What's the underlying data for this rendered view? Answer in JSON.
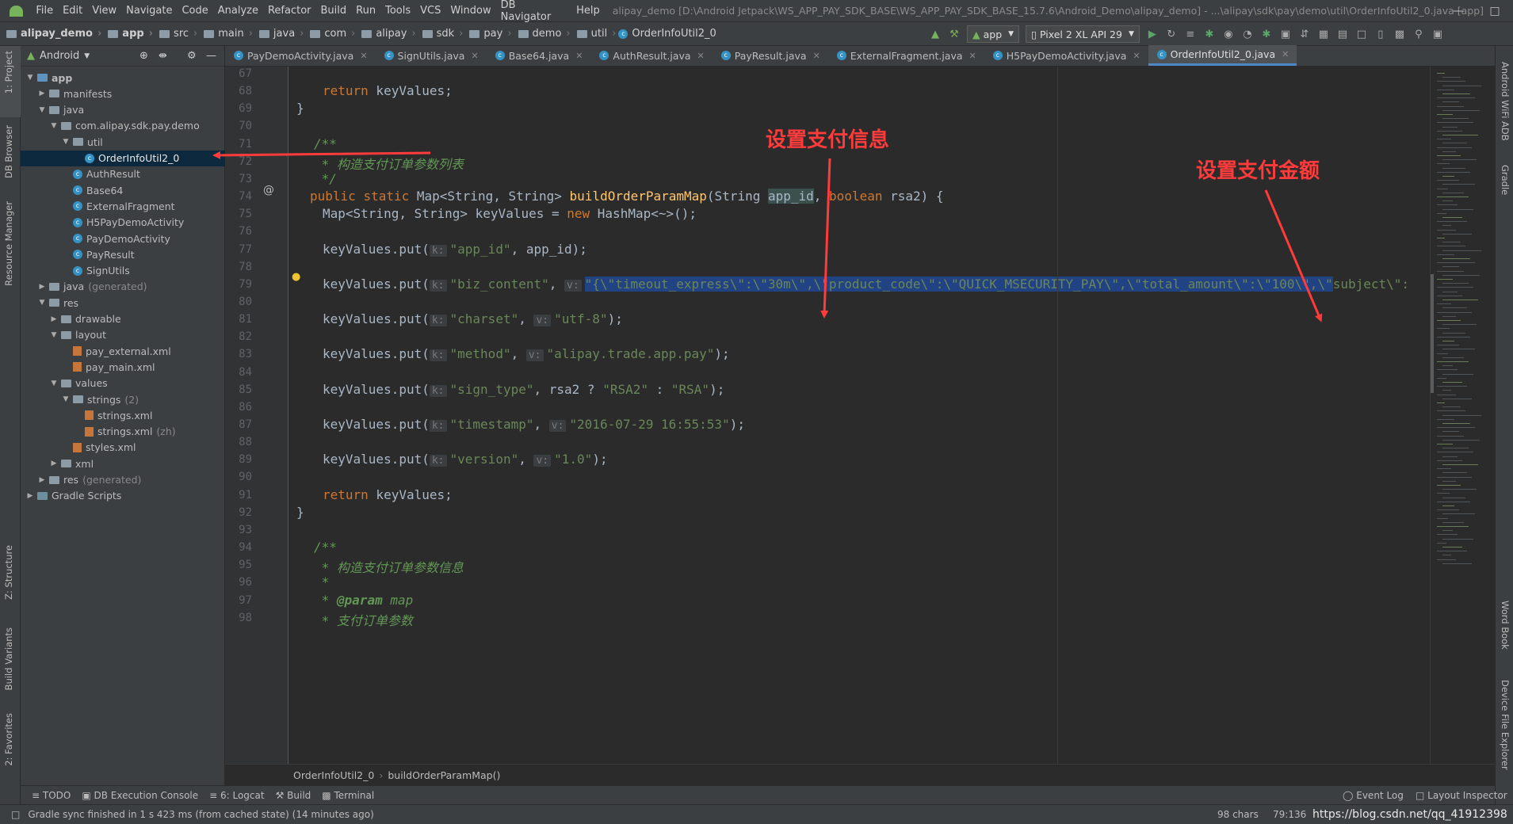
{
  "menu": {
    "items": [
      "File",
      "Edit",
      "View",
      "Navigate",
      "Code",
      "Analyze",
      "Refactor",
      "Build",
      "Run",
      "Tools",
      "VCS",
      "Window",
      "DB Navigator",
      "Help"
    ],
    "window_title": "alipay_demo [D:\\Android Jetpack\\WS_APP_PAY_SDK_BASE\\WS_APP_PAY_SDK_BASE_15.7.6\\Android_Demo\\alipay_demo] - ...\\alipay\\sdk\\pay\\demo\\util\\OrderInfoUtil2_0.java [app]"
  },
  "breadcrumb": [
    "alipay_demo",
    "app",
    "src",
    "main",
    "java",
    "com",
    "alipay",
    "sdk",
    "pay",
    "demo",
    "util",
    "OrderInfoUtil2_0"
  ],
  "toolbar": {
    "run_config": "app",
    "device": "Pixel 2 XL API 29"
  },
  "project": {
    "view_label": "Android",
    "tree": [
      {
        "label": "app",
        "depth": 0,
        "expanded": true,
        "icon": "module",
        "bold": true
      },
      {
        "label": "manifests",
        "depth": 1,
        "expanded": false,
        "icon": "folder"
      },
      {
        "label": "java",
        "depth": 1,
        "expanded": true,
        "icon": "folder"
      },
      {
        "label": "com.alipay.sdk.pay.demo",
        "depth": 2,
        "expanded": true,
        "icon": "package"
      },
      {
        "label": "util",
        "depth": 3,
        "expanded": true,
        "icon": "package"
      },
      {
        "label": "OrderInfoUtil2_0",
        "depth": 4,
        "icon": "class",
        "selected": true
      },
      {
        "label": "AuthResult",
        "depth": 3,
        "icon": "class"
      },
      {
        "label": "Base64",
        "depth": 3,
        "icon": "class"
      },
      {
        "label": "ExternalFragment",
        "depth": 3,
        "icon": "class"
      },
      {
        "label": "H5PayDemoActivity",
        "depth": 3,
        "icon": "class"
      },
      {
        "label": "PayDemoActivity",
        "depth": 3,
        "icon": "class"
      },
      {
        "label": "PayResult",
        "depth": 3,
        "icon": "class"
      },
      {
        "label": "SignUtils",
        "depth": 3,
        "icon": "class"
      },
      {
        "label": "java",
        "suffix": "(generated)",
        "depth": 1,
        "expanded": false,
        "icon": "folder"
      },
      {
        "label": "res",
        "depth": 1,
        "expanded": true,
        "icon": "folder"
      },
      {
        "label": "drawable",
        "depth": 2,
        "expanded": false,
        "icon": "folder"
      },
      {
        "label": "layout",
        "depth": 2,
        "expanded": true,
        "icon": "folder"
      },
      {
        "label": "pay_external.xml",
        "depth": 3,
        "icon": "xml"
      },
      {
        "label": "pay_main.xml",
        "depth": 3,
        "icon": "xml"
      },
      {
        "label": "values",
        "depth": 2,
        "expanded": true,
        "icon": "folder"
      },
      {
        "label": "strings",
        "suffix": "(2)",
        "depth": 3,
        "expanded": true,
        "icon": "folder"
      },
      {
        "label": "strings.xml",
        "depth": 4,
        "icon": "xml"
      },
      {
        "label": "strings.xml",
        "suffix": "(zh)",
        "depth": 4,
        "icon": "xml"
      },
      {
        "label": "styles.xml",
        "depth": 3,
        "icon": "xml"
      },
      {
        "label": "xml",
        "depth": 2,
        "expanded": false,
        "icon": "folder"
      },
      {
        "label": "res",
        "suffix": "(generated)",
        "depth": 1,
        "expanded": false,
        "icon": "folder"
      },
      {
        "label": "Gradle Scripts",
        "depth": 0,
        "expanded": false,
        "icon": "gradle"
      }
    ]
  },
  "left_tools": [
    "1: Project",
    "DB Browser",
    "Resource Manager",
    "Z: Structure",
    "Build Variants",
    "2: Favorites"
  ],
  "right_tools": [
    "Android WiFi ADB",
    "Gradle",
    "Word Book",
    "Device File Explorer"
  ],
  "tabs": [
    {
      "label": "PayDemoActivity.java",
      "active": false
    },
    {
      "label": "SignUtils.java",
      "active": false
    },
    {
      "label": "Base64.java",
      "active": false
    },
    {
      "label": "AuthResult.java",
      "active": false
    },
    {
      "label": "PayResult.java",
      "active": false
    },
    {
      "label": "ExternalFragment.java",
      "active": false
    },
    {
      "label": "H5PayDemoActivity.java",
      "active": false
    },
    {
      "label": "OrderInfoUtil2_0.java",
      "active": true
    }
  ],
  "code_lines": [
    67,
    68,
    69,
    70,
    71,
    72,
    73,
    74,
    75,
    76,
    77,
    78,
    79,
    80,
    81,
    82,
    83,
    84,
    85,
    86,
    87,
    88,
    89,
    90,
    91,
    92,
    93,
    94,
    95,
    96,
    97,
    98
  ],
  "code": {
    "l68_a": "return",
    "l68_b": " keyValues;",
    "l69": "}",
    "l71": "/**",
    "l72": " * 构造支付订单参数列表",
    "l73": " */",
    "l74_public": "public",
    "l74_static": "static",
    "l74_type": "Map<String, String> ",
    "l74_fn": "buildOrderParamMap",
    "l74_p1": "(String ",
    "l74_appid": "app_id",
    "l74_comma": ", ",
    "l74_bool": "boolean",
    "l74_rest": " rsa2) {",
    "l75_a": "Map<String, String> keyValues = ",
    "l75_new": "new",
    "l75_b": " HashMap<~>();",
    "l77_a": "keyValues.put(",
    "hint_k": "k:",
    "l77_s": "\"app_id\"",
    "l77_b": ", app_id);",
    "l79_a": "keyValues.put(",
    "l79_s": "\"biz_content\"",
    "l79_c": ", ",
    "hint_v": "v:",
    "l79_sel": "\"{\\\"timeout_express\\\":\\\"30m\\\",\\\"product_code\\\":\\\"QUICK_MSECURITY_PAY\\\",\\\"total_amount\\\":\\\"100\\\",\\\"",
    "l79_tail": "subject\\\":",
    "l81_s": "\"charset\"",
    "l81_v": "\"utf-8\"",
    "l81_end": ");",
    "l83_s": "\"method\"",
    "l83_v": "\"alipay.trade.app.pay\"",
    "l83_end": ");",
    "l85_s": "\"sign_type\"",
    "l85_mid": ", rsa2 ? ",
    "l85_v1": "\"RSA2\"",
    "l85_colon": " : ",
    "l85_v2": "\"RSA\"",
    "l85_end": ");",
    "l87_s": "\"timestamp\"",
    "l87_v": "\"2016-07-29 16:55:53\"",
    "l87_end": ");",
    "l89_s": "\"version\"",
    "l89_v": "\"1.0\"",
    "l89_end": ");",
    "comma": ", ",
    "l91_a": "return",
    "l91_b": " keyValues;",
    "l92": "}",
    "l94": "/**",
    "l95": " * 构造支付订单参数信息",
    "l96": " *",
    "l97_star": " * ",
    "l97_tag": "@param",
    "l97_rest": " map",
    "l98": " * 支付订单参数"
  },
  "annotations": {
    "left": "设置支付信息",
    "right": "设置支付金额"
  },
  "editor_breadcrumb": [
    "OrderInfoUtil2_0",
    "buildOrderParamMap()"
  ],
  "tool_windows": [
    "TODO",
    "DB Execution Console",
    "6: Logcat",
    "Build",
    "Terminal"
  ],
  "tool_windows_right": [
    "Event Log",
    "Layout Inspector"
  ],
  "status": {
    "message": "Gradle sync finished in 1 s 423 ms (from cached state) (14 minutes ago)",
    "chars": "98 chars",
    "position": "79:136",
    "watermark": "https://blog.csdn.net/qq_41912398"
  },
  "colors": {
    "annotation": "#ff3b3b",
    "selection": "#214283",
    "keyword": "#cc7832",
    "string": "#6a8759"
  }
}
